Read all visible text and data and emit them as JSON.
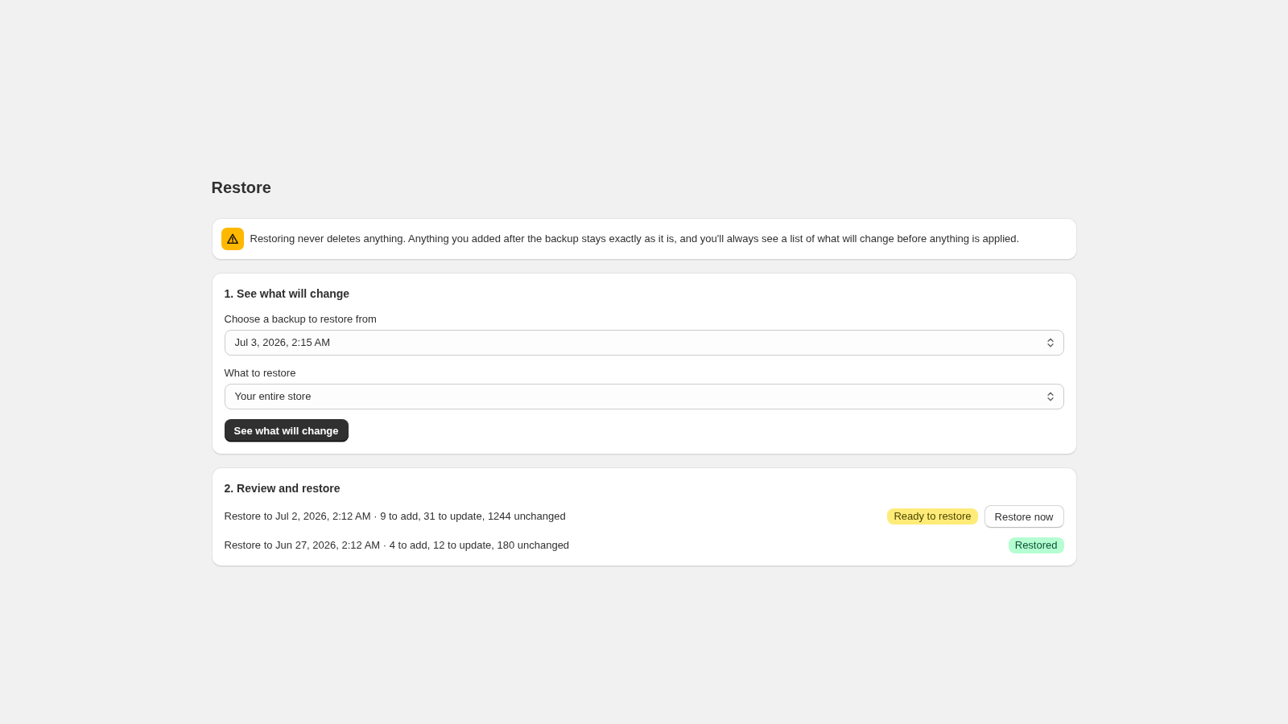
{
  "page": {
    "title": "Restore"
  },
  "notice": {
    "kind": "warning",
    "text": "Restoring never deletes anything. Anything you added after the backup stays exactly as it is, and you'll always see a list of what will change before anything is applied."
  },
  "preview_step": {
    "title": "1. See what will change",
    "fields": [
      {
        "label": "Choose a backup to restore from",
        "value": "Jul 3, 2026, 2:15 AM"
      },
      {
        "label": "What to restore",
        "value": "Your entire store"
      }
    ],
    "button": "See what will change"
  },
  "review_step": {
    "title": "2. Review and restore",
    "restores": [
      {
        "text": "Restore to Jul 2, 2026, 2:12 AM · 9 to add, 31 to update, 1244 unchanged",
        "status": {
          "label": "Ready to restore",
          "kind": "attention"
        },
        "action": "Restore now"
      },
      {
        "text": "Restore to Jun 27, 2026, 2:12 AM · 4 to add, 12 to update, 180 unchanged",
        "status": {
          "label": "Restored",
          "kind": "success"
        }
      }
    ]
  }
}
